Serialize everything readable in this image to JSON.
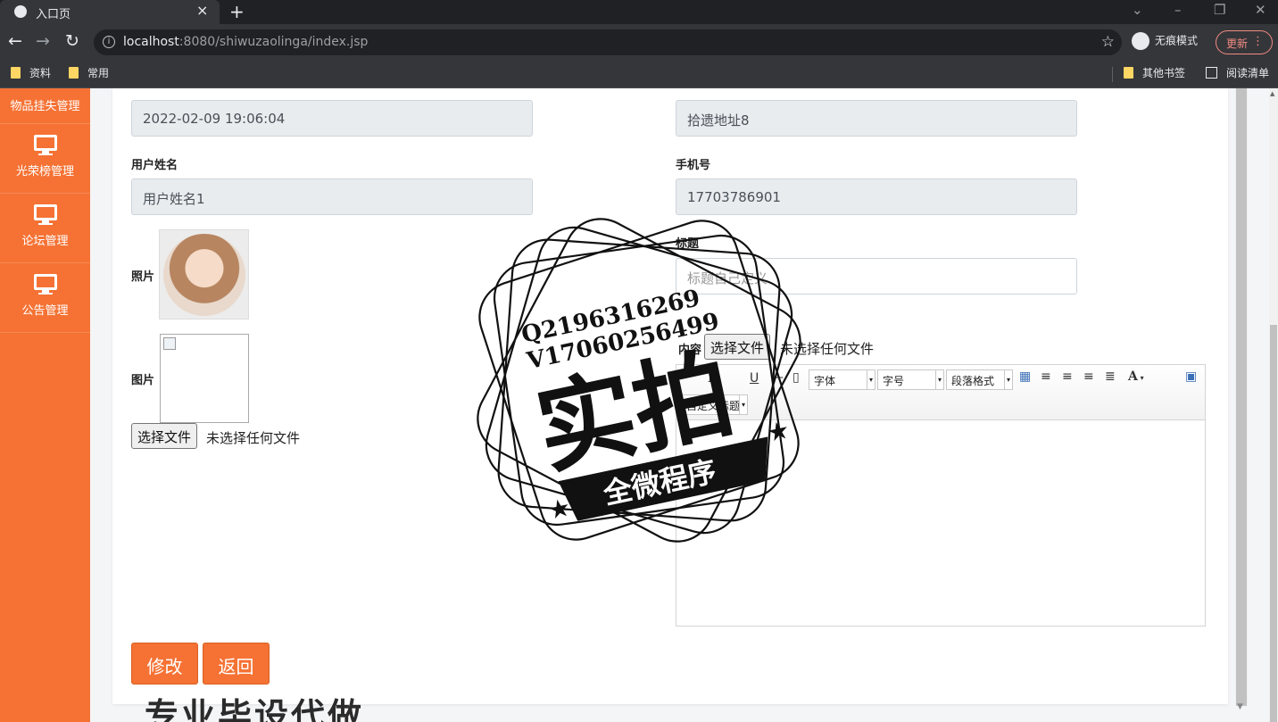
{
  "browser": {
    "tab_title": "入口页",
    "url_host": "localhost",
    "url_rest": ":8080/shiwuzaolinga/index.jsp",
    "incognito_label": "无痕模式",
    "update_label": "更新",
    "bookmarks": [
      "资料",
      "常用"
    ],
    "bookmarks_right": [
      "其他书签",
      "阅读清单"
    ]
  },
  "sidebar": {
    "top_label": "物品挂失管理",
    "items": [
      {
        "label": "光荣榜管理",
        "icon": "monitor-icon"
      },
      {
        "label": "论坛管理",
        "icon": "monitor-icon"
      },
      {
        "label": "公告管理",
        "icon": "monitor-icon"
      }
    ]
  },
  "form": {
    "time_value": "2022-02-09 19:06:04",
    "address_value": "拾遗地址8",
    "username_label": "用户姓名",
    "username_value": "用户姓名1",
    "phone_label": "手机号",
    "phone_value": "17703786901",
    "photo_label": "照片",
    "image_label": "图片",
    "title_label": "标题",
    "title_placeholder": "标题自己定义",
    "content_label": "内容",
    "choose_file": "选择文件",
    "no_file": "未选择任何文件",
    "editor": {
      "bold": "B",
      "underline": "U",
      "font_select": "字体",
      "size_select": "字号",
      "paragraph_select": "段落格式",
      "heading_select": "自定义标题",
      "font_color": "A"
    },
    "modify_button": "修改",
    "back_button": "返回"
  },
  "stamp": {
    "qq": "Q2196316269",
    "vx": "V17060256499",
    "main": "实拍",
    "ribbon": "全微程序",
    "bottom_text": "专业毕设代做"
  }
}
